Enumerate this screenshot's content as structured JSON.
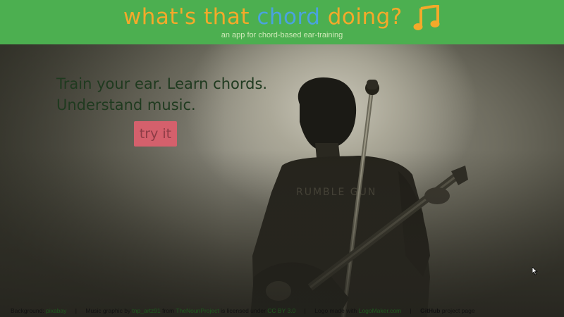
{
  "header": {
    "title_part1": "what's that ",
    "title_chord": "chord",
    "title_part2": " doing?",
    "subtitle": "an app for chord-based ear-training",
    "icon": "music-note-icon"
  },
  "hero": {
    "tagline_line1": "Train your ear. Learn chords.",
    "tagline_line2": "Understand music.",
    "try_label": "try it",
    "shirt_text": "RUMBLE GUN"
  },
  "footer": {
    "bg_prefix": "Background:",
    "bg_link": "pixabay",
    "music_prefix": "Music graphic by",
    "music_author": "tnp_artz91",
    "music_from": "from",
    "music_source": "TheNounProject",
    "license_prefix": "is licensed under",
    "license_link": "CC BY 3.0",
    "logo_prefix": "Logo made with",
    "logo_link": "LogoMaker.com",
    "github_label": "GitHub",
    "project_label": "project page",
    "separator": "|"
  },
  "colors": {
    "header_bg": "#4caf50",
    "title_orange": "#f4a92a",
    "title_blue": "#4aa3df",
    "button_bg": "#d4606c"
  }
}
